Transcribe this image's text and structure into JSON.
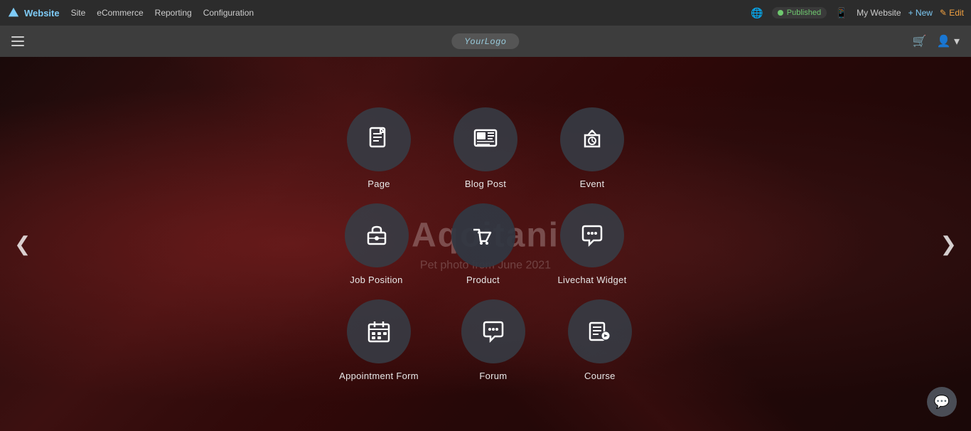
{
  "topnav": {
    "brand": "Website",
    "links": [
      "Site",
      "eCommerce",
      "Reporting",
      "Configuration"
    ],
    "published": "Published",
    "my_website": "My Website",
    "new_btn": "+ New",
    "edit_btn": "✎ Edit"
  },
  "secondary_nav": {
    "logo_text": "YourLogo"
  },
  "arrows": {
    "left": "❮",
    "right": "❯"
  },
  "slide": {
    "title": "Aqoitani",
    "subtitle": "Pet photo from June 2021"
  },
  "icons": [
    {
      "row": 0,
      "items": [
        {
          "id": "page",
          "label": "Page",
          "icon": "page"
        },
        {
          "id": "blog-post",
          "label": "Blog Post",
          "icon": "blog"
        },
        {
          "id": "event",
          "label": "Event",
          "icon": "event"
        }
      ]
    },
    {
      "row": 1,
      "items": [
        {
          "id": "job-position",
          "label": "Job Position",
          "icon": "job"
        },
        {
          "id": "product",
          "label": "Product",
          "icon": "product"
        },
        {
          "id": "livechat-widget",
          "label": "Livechat Widget",
          "icon": "livechat"
        }
      ]
    },
    {
      "row": 2,
      "items": [
        {
          "id": "appointment-form",
          "label": "Appointment Form",
          "icon": "appointment"
        },
        {
          "id": "forum",
          "label": "Forum",
          "icon": "forum"
        },
        {
          "id": "course",
          "label": "Course",
          "icon": "course"
        }
      ]
    }
  ],
  "colors": {
    "published": "#6fc86f",
    "new": "#7ecbf7",
    "edit": "#f0a040"
  }
}
